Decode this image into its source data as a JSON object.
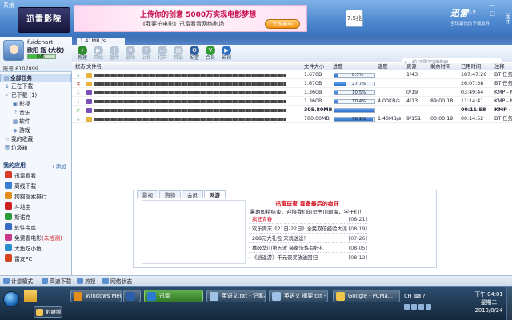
{
  "system": {
    "label": "系统"
  },
  "banner": {
    "logo_text": "迅雷影院",
    "ad_title": "上传你的创意 5000万实现电影梦想",
    "ad_subtitle": "《我要拍电影》迅雷看看网络剧场",
    "ad_button": "立即参与",
    "speed_widget": "7.5兆",
    "brand_name": "迅雷",
    "brand_version": "5.9",
    "brand_slogan": "全球最快的下载软件",
    "window_controls": [
      "—",
      "□"
    ],
    "close_label": "关闭"
  },
  "profile": {
    "username": "fuidenart",
    "vip_line": "欧阳  瓶  (大枚)",
    "level_text": "LV6",
    "level_fill_ratio": 0.55,
    "account_line": "账号 8107899"
  },
  "nav": {
    "all": "全部任务",
    "downloading": "正在下载",
    "completed": "已下载 (1)",
    "categories": [
      "影视",
      "音乐",
      "软件",
      "游戏"
    ],
    "favorites": "我的收藏",
    "trash": "垃圾箱"
  },
  "apps": {
    "header": "我的应用",
    "add_label": "+添加",
    "items": [
      {
        "label": "迅雷看看",
        "color": "#d83a2a",
        "tag": ""
      },
      {
        "label": "离线下载",
        "color": "#3a7dd1",
        "tag": ""
      },
      {
        "label": "狗狗搜索排行",
        "color": "#e38e1c",
        "tag": ""
      },
      {
        "label": "斗地主",
        "color": "#d01f1f",
        "tag": ""
      },
      {
        "label": "斯诺克",
        "color": "#2c9a3a",
        "tag": ""
      },
      {
        "label": "软件宝库",
        "color": "#3a6cc1",
        "tag": ""
      },
      {
        "label": "免费看电影",
        "color": "#c83a8a",
        "tag": "(未检测)"
      },
      {
        "label": "大鱼吃小鱼",
        "color": "#2b8dcb",
        "tag": ""
      },
      {
        "label": "雷友FC",
        "color": "#d8431f",
        "tag": ""
      }
    ]
  },
  "content": {
    "active_tab": "1.41MB /s",
    "toolbar": [
      {
        "label": "新建",
        "icon": "plus-icon",
        "color": "#2e8b2e",
        "dim": false
      },
      {
        "label": "开始",
        "icon": "play-icon",
        "color": "#3a6fb7",
        "dim": true
      },
      {
        "label": "暂停",
        "icon": "pause-icon",
        "color": "#3a6fb7",
        "dim": true
      },
      {
        "label": "删除",
        "icon": "delete-icon",
        "color": "#c23b2b",
        "dim": true
      },
      {
        "label": "上移",
        "icon": "up-icon",
        "color": "#3a6fb7",
        "dim": true
      },
      {
        "label": "打开",
        "icon": "open-icon",
        "color": "#3a6fb7",
        "dim": true
      },
      {
        "label": "目录",
        "icon": "folder-icon",
        "color": "#3a6fb7",
        "dim": true
      },
      {
        "label": "配置",
        "icon": "gear-icon",
        "color": "#2f5f9e",
        "dim": false
      },
      {
        "label": "会员",
        "icon": "vip-icon",
        "color": "#2f9a35",
        "dim": false
      },
      {
        "label": "影视",
        "icon": "film-icon",
        "color": "#2f6fc2",
        "dim": false
      }
    ],
    "search_placeholder": "按迅雷官网搜索"
  },
  "table": {
    "headers": [
      "状态",
      "文件名",
      "文件大小",
      "进度",
      "速度",
      "资源",
      "剩余时间",
      "已用时间",
      "注释"
    ],
    "rows": [
      {
        "status": "↓",
        "status_color": "#2e9a2e",
        "file_color": "#e7b33a",
        "size": "1.670B",
        "progress": 0.085,
        "progress_label": "8.5%",
        "speed": "",
        "sources": "1/43",
        "remaining": "",
        "elapsed": "187:47:26",
        "note": "BT 任务",
        "bold": false
      },
      {
        "status": "✕",
        "status_color": "#b93535",
        "file_color": "#e7b33a",
        "size": "1.670B",
        "progress": 0.277,
        "progress_label": "27.7%",
        "speed": "",
        "sources": "",
        "remaining": "",
        "elapsed": "26:07:38",
        "note": "BT 任务",
        "bold": false
      },
      {
        "status": "↓",
        "status_color": "#2e9a2e",
        "file_color": "#7a4fb8",
        "size": "1.360B",
        "progress": 0.105,
        "progress_label": "10.5%",
        "speed": "",
        "sources": "0/19",
        "remaining": "",
        "elapsed": "03:49:44",
        "note": "KMP - Mc",
        "bold": false
      },
      {
        "status": "↓",
        "status_color": "#2e9a2e",
        "file_color": "#7a4fb8",
        "size": "1.360B",
        "progress": 0.104,
        "progress_label": "10.4%",
        "speed": "4.00KB/s",
        "sources": "4/13",
        "remaining": "89:00:18",
        "elapsed": "11:14:41",
        "note": "KMP - Mc",
        "bold": false
      },
      {
        "status": "✓",
        "status_color": "#2e9a2e",
        "file_color": "#7a4fb8",
        "size": "305.80MB",
        "progress": 1.0,
        "progress_label": "",
        "speed": "",
        "sources": "",
        "remaining": "",
        "elapsed": "00:11:58",
        "note": "KMP - R",
        "bold": true
      },
      {
        "status": "↓",
        "status_color": "#2e9a2e",
        "file_color": "#e7b33a",
        "size": "700.00MB",
        "progress": 0.961,
        "progress_label": "96.1%",
        "speed": "1.40MB/s",
        "sources": "9/151",
        "remaining": "00:00:19",
        "elapsed": "00:14:52",
        "note": "BT 任务",
        "bold": false
      }
    ]
  },
  "bottom_panel": {
    "tabs": [
      "影视",
      "购物",
      "会员",
      "网游"
    ],
    "promo_title": "迅雷玩家  筹备最后的疯狂",
    "promo_subtitle": "暑期即将结束，迎接我们的是书山题海，学子们！",
    "news": [
      {
        "title": "· 疯狂青春",
        "date": "[08-21]",
        "hot": true
      },
      {
        "title": "· 欢乐周末《21日-22日》全民双倍经验大派",
        "date": "[08-19]",
        "hot": false
      },
      {
        "title": "· 288元大礼包 来就送送！",
        "date": "[07-26]",
        "hot": false
      },
      {
        "title": "· 嘉岐华山第五波 装备洗炼有好礼",
        "date": "[08-05]",
        "hot": false
      },
      {
        "title": "· 《逍遥游》千元豪奖放送回归",
        "date": "[08-12]",
        "hot": false
      }
    ]
  },
  "statusbar": {
    "items": [
      "计量模式",
      "高速下载",
      "热搜",
      "网络状态"
    ]
  },
  "taskbar": {
    "buttons": [
      {
        "label": "Windows Media...",
        "color": "#e38e1c",
        "active": false
      },
      {
        "label": "",
        "color": "#2b5da8",
        "active": false
      },
      {
        "label": "迅雷",
        "color": "#2a7cd3",
        "active": true
      },
      {
        "label": "英语文.txt - 记事本",
        "color": "#9fc3e6",
        "active": false
      },
      {
        "label": "英语文 摘要.txt - ...",
        "color": "#9fc3e6",
        "active": false
      },
      {
        "label": "Google - PCMa...",
        "color": "#f0c64a",
        "active": false
      }
    ],
    "second_row_label": "射雕版",
    "tray_lang": "CH  ⌨  ?",
    "clock_time": "下午 04:01",
    "clock_day": "星期二",
    "clock_date": "2010/8/24"
  }
}
